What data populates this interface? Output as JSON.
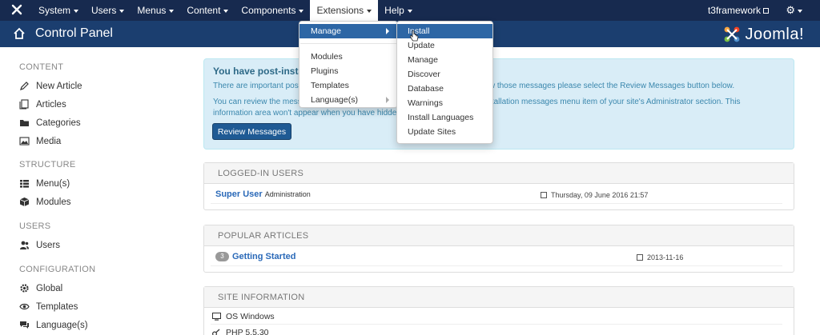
{
  "nav": {
    "menus": [
      {
        "label": "System"
      },
      {
        "label": "Users"
      },
      {
        "label": "Menus"
      },
      {
        "label": "Content"
      },
      {
        "label": "Components"
      },
      {
        "label": "Extensions"
      },
      {
        "label": "Help"
      }
    ],
    "site_name": "t3framework",
    "nav_bg": "#172a4f"
  },
  "header": {
    "title": "Control Panel",
    "brand": "Joomla!",
    "header_bg": "#1b3e6f"
  },
  "sidebar": {
    "content_heading": "CONTENT",
    "content_items": [
      "New Article",
      "Articles",
      "Categories",
      "Media"
    ],
    "structure_heading": "STRUCTURE",
    "structure_items": [
      "Menu(s)",
      "Modules"
    ],
    "users_heading": "USERS",
    "users_items": [
      "Users"
    ],
    "config_heading": "CONFIGURATION",
    "config_items": [
      "Global",
      "Templates",
      "Language(s)"
    ]
  },
  "alert": {
    "title": "You have post-install",
    "p1_left": "There are important post-",
    "p1_right": "w those messages please select the Review Messages button below.",
    "p2_line1_left": "You can review the mess",
    "p2_line1_right": "stallation messages menu item of your site's Administrator section. This",
    "p2_line2": "information area won't appear when you have hidden",
    "button": "Review Messages"
  },
  "logged_in": {
    "heading": "LOGGED-IN USERS",
    "user": "Super User",
    "role": "Administration",
    "date": "Thursday, 09 June 2016 21:57"
  },
  "popular": {
    "heading": "POPULAR ARTICLES",
    "hits": "3",
    "article": "Getting Started",
    "date": "2013-11-16"
  },
  "site_info": {
    "heading": "SITE INFORMATION",
    "os": "OS Windows",
    "php": "PHP 5.5.30"
  },
  "extensions_menu": {
    "items": [
      "Manage",
      "Modules",
      "Plugins",
      "Templates",
      "Language(s)"
    ]
  },
  "manage_submenu": {
    "items": [
      "Install",
      "Update",
      "Manage",
      "Discover",
      "Database",
      "Warnings",
      "Install Languages",
      "Update Sites"
    ]
  },
  "colors": {
    "highlight": "#2d66a5",
    "alert_bg": "#d9edf7",
    "link": "#2a69b8"
  }
}
